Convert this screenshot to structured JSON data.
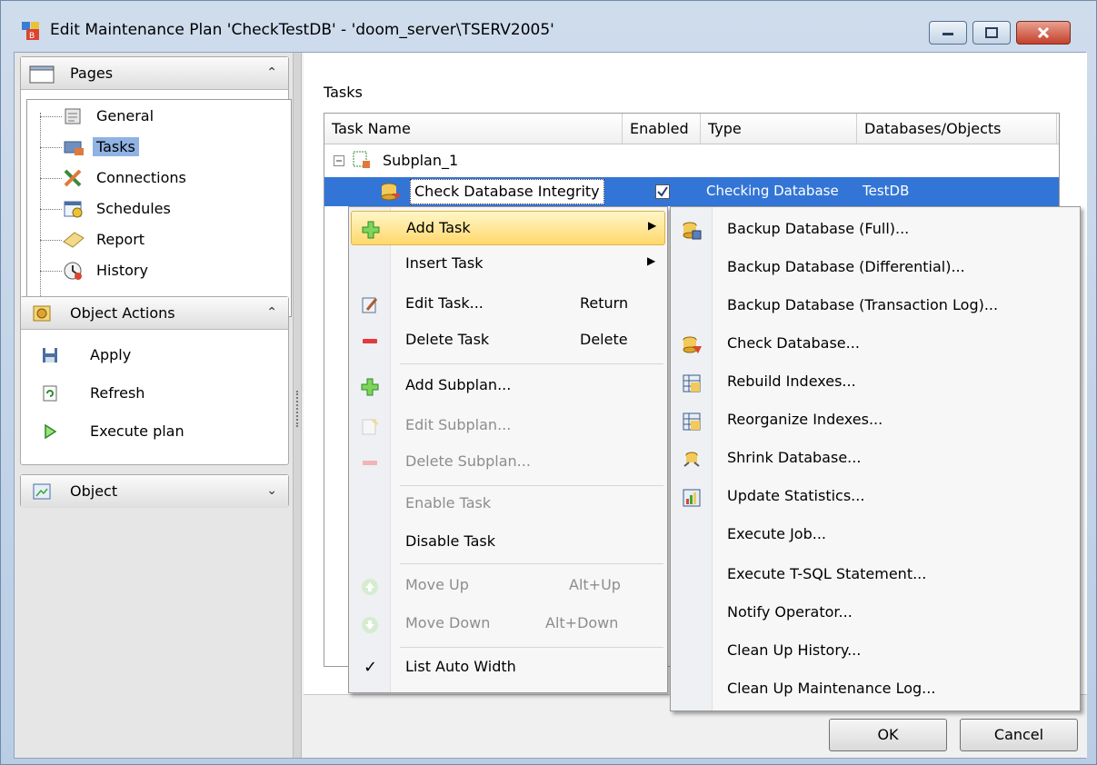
{
  "window": {
    "title": "Edit Maintenance Plan 'CheckTestDB' - 'doom_server\\TSERV2005'",
    "controls": [
      "minimize",
      "maximize",
      "close"
    ]
  },
  "sidebar": {
    "pages": {
      "title": "Pages",
      "items": [
        {
          "label": "General",
          "icon": "general-icon"
        },
        {
          "label": "Tasks",
          "icon": "tasks-icon",
          "selected": true
        },
        {
          "label": "Connections",
          "icon": "connections-icon"
        },
        {
          "label": "Schedules",
          "icon": "schedules-icon"
        },
        {
          "label": "Report",
          "icon": "report-icon"
        },
        {
          "label": "History",
          "icon": "history-icon"
        }
      ]
    },
    "object_actions": {
      "title": "Object Actions",
      "items": [
        {
          "label": "Apply",
          "icon": "save-icon"
        },
        {
          "label": "Refresh",
          "icon": "refresh-icon"
        },
        {
          "label": "Execute plan",
          "icon": "play-icon"
        }
      ]
    },
    "object": {
      "title": "Object"
    }
  },
  "main": {
    "section_label": "Tasks",
    "grid": {
      "columns": [
        "Task Name",
        "Enabled",
        "Type",
        "Databases/Objects"
      ],
      "rows": [
        {
          "task_name": "Subplan_1",
          "enabled": "",
          "type": "",
          "databases": ""
        },
        {
          "task_name": "Check Database Integrity",
          "enabled": "checked",
          "type": "Checking Database",
          "databases": "TestDB"
        }
      ]
    },
    "buttons": {
      "ok": "OK",
      "cancel": "Cancel"
    }
  },
  "context_menu": {
    "items": {
      "add_task": "Add Task",
      "insert_task": "Insert Task",
      "edit_task": "Edit Task...",
      "edit_task_shortcut": "Return",
      "delete_task": "Delete Task",
      "delete_task_shortcut": "Delete",
      "add_subplan": "Add Subplan...",
      "edit_subplan": "Edit Subplan...",
      "delete_subplan": "Delete Subplan...",
      "enable_task": "Enable Task",
      "disable_task": "Disable Task",
      "move_up": "Move Up",
      "move_up_shortcut": "Alt+Up",
      "move_down": "Move Down",
      "move_down_shortcut": "Alt+Down",
      "list_auto_width": "List Auto Width"
    },
    "check_mark": "✓"
  },
  "submenu": {
    "items": [
      "Backup Database (Full)...",
      "Backup Database (Differential)...",
      "Backup Database (Transaction Log)...",
      "Check Database...",
      "Rebuild Indexes...",
      "Reorganize Indexes...",
      "Shrink Database...",
      "Update Statistics...",
      "Execute Job...",
      "Execute T-SQL Statement...",
      "Notify Operator...",
      "Clean Up History...",
      "Clean Up Maintenance Log..."
    ]
  },
  "colors": {
    "selection": "#3375d6",
    "menu_hot": "#ffd86b",
    "accent_green": "#3aa83a"
  }
}
